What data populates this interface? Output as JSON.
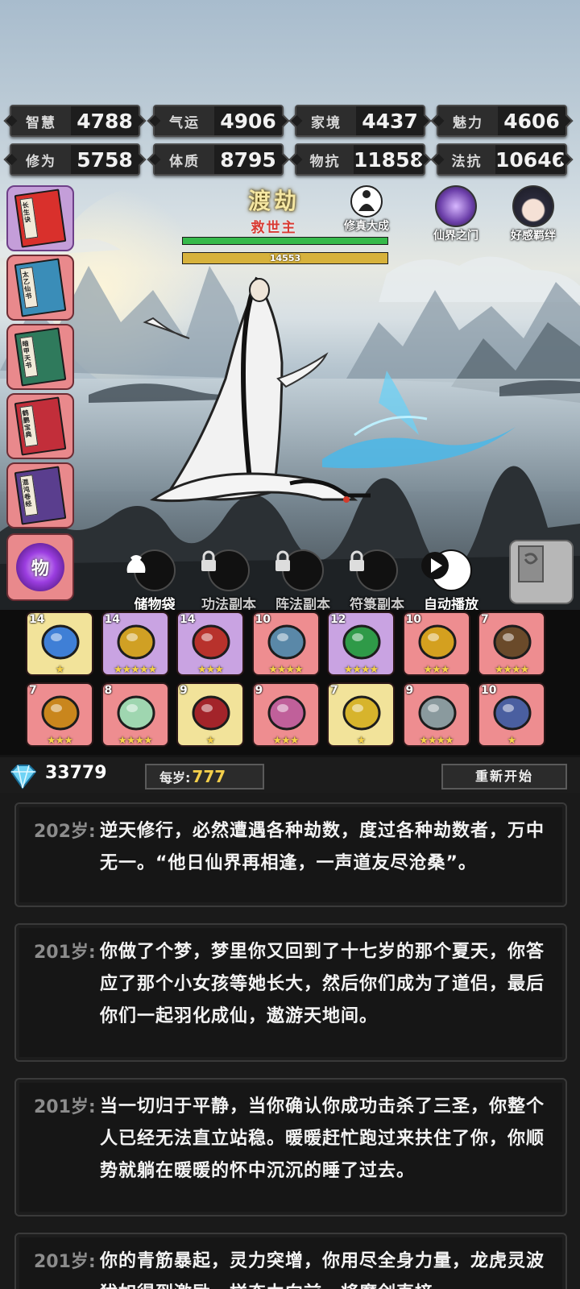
{
  "stats": [
    {
      "label": "智慧",
      "value": "4788"
    },
    {
      "label": "气运",
      "value": "4906"
    },
    {
      "label": "家境",
      "value": "4437"
    },
    {
      "label": "魅力",
      "value": "4606"
    },
    {
      "label": "修为",
      "value": "5758"
    },
    {
      "label": "体质",
      "value": "8795"
    },
    {
      "label": "物抗",
      "value": "11858"
    },
    {
      "label": "法抗",
      "value": "10646"
    }
  ],
  "hero": {
    "realm": "渡劫",
    "epithet": "救世主",
    "exp": "14553",
    "hp_fraction": 1.0,
    "exp_fraction": 1.0
  },
  "top_icons": {
    "cultivate": "修真大成",
    "gate": "仙界之门",
    "bond": "好感羁绊"
  },
  "books": [
    {
      "title": "长生诀",
      "color": "purple"
    },
    {
      "title": "太乙仙书",
      "color": "red"
    },
    {
      "title": "暗甲天书",
      "color": "red"
    },
    {
      "title": "鹤鹏宝典",
      "color": "red"
    },
    {
      "title": "混沌卷经",
      "color": "red"
    }
  ],
  "items_button": "物",
  "actions": [
    {
      "label": "储物袋",
      "locked": false
    },
    {
      "label": "功法副本",
      "locked": true
    },
    {
      "label": "阵法副本",
      "locked": true
    },
    {
      "label": "符箓副本",
      "locked": true
    },
    {
      "label": "自动播放",
      "locked": false
    }
  ],
  "items": [
    {
      "level": "14",
      "stars": 1,
      "bg": "gold",
      "icon": "ring-icon"
    },
    {
      "level": "14",
      "stars": 5,
      "bg": "purple",
      "icon": "gourd-icon"
    },
    {
      "level": "14",
      "stars": 3,
      "bg": "purple",
      "icon": "bracelet-icon"
    },
    {
      "level": "10",
      "stars": 4,
      "bg": "red",
      "icon": "dagger-icon"
    },
    {
      "level": "12",
      "stars": 4,
      "bg": "purple",
      "icon": "claw-icon"
    },
    {
      "level": "10",
      "stars": 3,
      "bg": "red",
      "icon": "amulet-icon"
    },
    {
      "level": "7",
      "stars": 4,
      "bg": "red",
      "icon": "hammer-icon"
    },
    {
      "level": "7",
      "stars": 3,
      "bg": "red",
      "icon": "cauldron-icon"
    },
    {
      "level": "8",
      "stars": 4,
      "bg": "red",
      "icon": "jade-seal-icon"
    },
    {
      "level": "9",
      "stars": 1,
      "bg": "gold",
      "icon": "sword-icon"
    },
    {
      "level": "9",
      "stars": 3,
      "bg": "red",
      "icon": "scroll-icon"
    },
    {
      "level": "7",
      "stars": 1,
      "bg": "gold",
      "icon": "staff-icon"
    },
    {
      "level": "9",
      "stars": 4,
      "bg": "red",
      "icon": "axe-icon"
    },
    {
      "level": "10",
      "stars": 1,
      "bg": "red",
      "icon": "spear-icon"
    }
  ],
  "currency": {
    "gems": "33779",
    "age_label": "每岁:",
    "age_value": "777",
    "restart": "重新开始"
  },
  "log": [
    {
      "age": "202岁:",
      "text": "逆天修行，必然遭遇各种劫数，度过各种劫数者，万中无一。“他日仙界再相逢，一声道友尽沧桑”。"
    },
    {
      "age": "201岁:",
      "text": "你做了个梦，梦里你又回到了十七岁的那个夏天，你答应了那个小女孩等她长大，然后你们成为了道侣，最后你们一起羽化成仙，遨游天地间。"
    },
    {
      "age": "201岁:",
      "text": "当一切归于平静，当你确认你成功击杀了三圣，你整个人已经无法直立站稳。暖暖赶忙跑过来扶住了你，你顺势就躺在暖暖的怀中沉沉的睡了过去。"
    },
    {
      "age": "201岁:",
      "text": "你的青筋暴起，灵力突增，你用尽全身力量，龙虎灵波犹如得到激励一样奋力向前，将魔剑直接"
    }
  ]
}
